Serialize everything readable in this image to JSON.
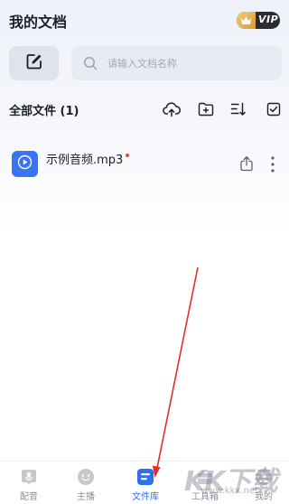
{
  "header": {
    "title": "我的文档",
    "vip_label": "VIP"
  },
  "search": {
    "placeholder": "请输入文档名称"
  },
  "file_section": {
    "title": "全部文件 (1)",
    "toolbar_icons": [
      "upload-cloud-icon",
      "new-folder-icon",
      "sort-icon",
      "multi-select-icon"
    ]
  },
  "files": [
    {
      "name": "示例音频.mp3",
      "type_icon": "play-icon",
      "is_new": true
    }
  ],
  "tabbar": {
    "tabs": [
      {
        "label": "配音",
        "icon": "dubbing-icon"
      },
      {
        "label": "主播",
        "icon": "anchor-icon"
      },
      {
        "label": "文件库",
        "icon": "file-library-icon",
        "active": true
      },
      {
        "label": "工具箱",
        "icon": "toolbox-icon"
      },
      {
        "label": "我的",
        "icon": "profile-icon"
      }
    ]
  },
  "watermark": {
    "big_text": "KK下载",
    "small_text": "www.kkx.net"
  },
  "colors": {
    "accent": "#2f6ff2",
    "file_icon_bg": "#3a74f6",
    "new_dot": "#e34a4a",
    "annotation_arrow": "#e0302a"
  }
}
